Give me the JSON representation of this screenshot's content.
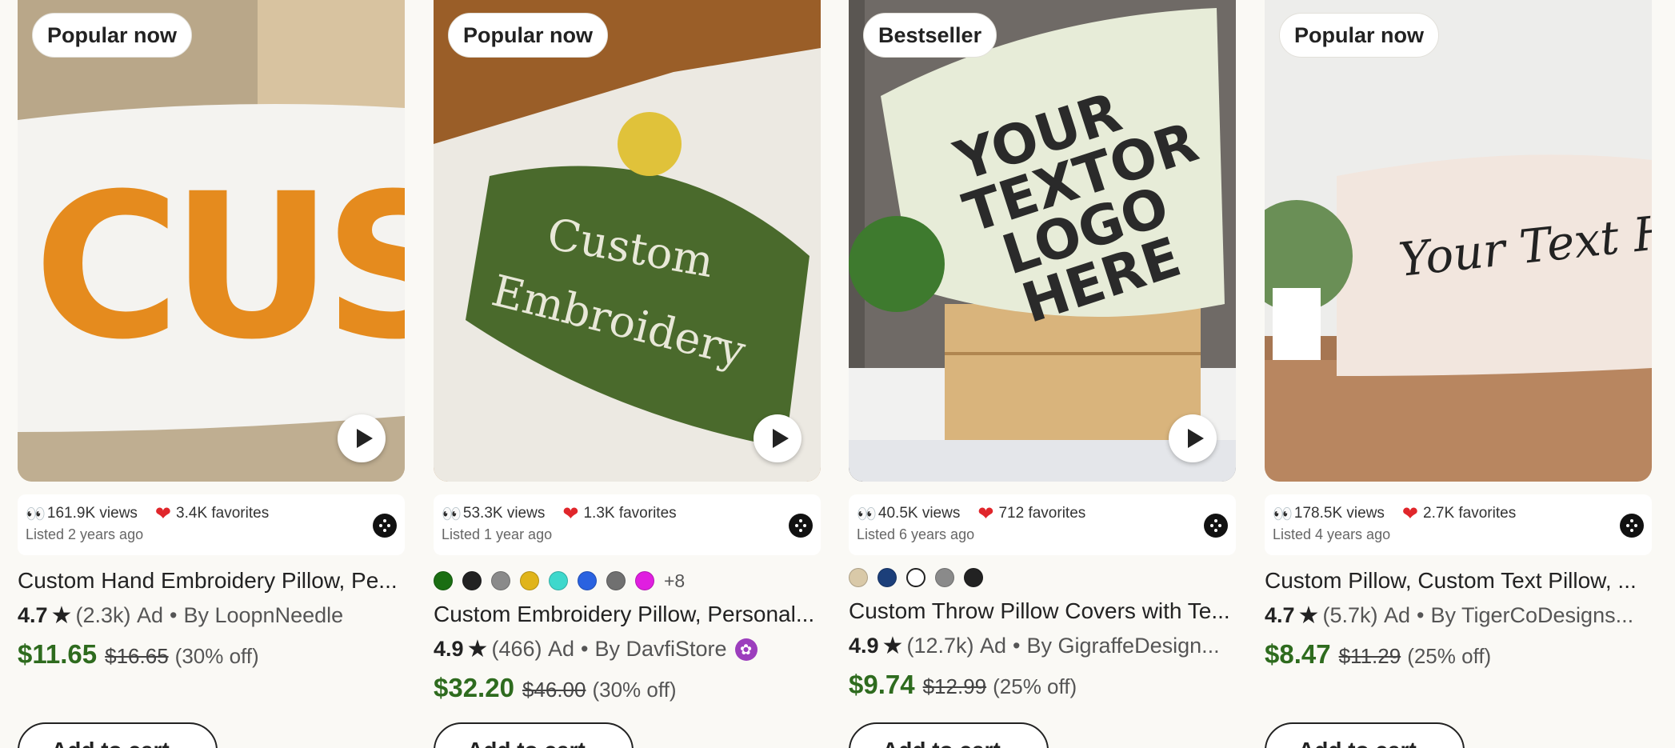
{
  "cards": [
    {
      "badge": "Popular now",
      "views": "161.9K views",
      "favorites": "3.4K favorites",
      "listed": "Listed 2 years ago",
      "title": "Custom Hand Embroidery Pillow, Pe...",
      "rating": "4.7",
      "reviews": "(2.3k)",
      "ad": "Ad",
      "shop": "By LoopnNeedle",
      "price": "$11.65",
      "original_price": "$16.65",
      "discount": "(30% off)",
      "add_label": "Add to cart"
    },
    {
      "badge": "Popular now",
      "views": "53.3K views",
      "favorites": "1.3K favorites",
      "listed": "Listed 1 year ago",
      "swatches": [
        "#1a6e12",
        "#222222",
        "#8a8a8a",
        "#e0b41a",
        "#3ed8cc",
        "#2a62e0",
        "#707070",
        "#e01ee0"
      ],
      "swatch_more": "+8",
      "title": "Custom Embroidery Pillow, Personal...",
      "rating": "4.9",
      "reviews": "(466)",
      "ad": "Ad",
      "shop": "By DavfiStore",
      "price": "$32.20",
      "original_price": "$46.00",
      "discount": "(30% off)",
      "add_label": "Add to cart",
      "photo_text_1": "Custom",
      "photo_text_2": "Embroidery"
    },
    {
      "badge": "Bestseller",
      "views": "40.5K views",
      "favorites": "712 favorites",
      "listed": "Listed 6 years ago",
      "swatches": [
        "#d9c9a8",
        "#1c3f7a",
        "#ffffff",
        "#8a8a8a",
        "#222222"
      ],
      "title": "Custom Throw Pillow Covers with Te...",
      "rating": "4.9",
      "reviews": "(12.7k)",
      "ad": "Ad",
      "shop": "By GigraffeDesign...",
      "price": "$9.74",
      "original_price": "$12.99",
      "discount": "(25% off)",
      "add_label": "Add to cart",
      "photo_text_1": "YOUR",
      "photo_text_2": "TEXTOR",
      "photo_text_3": "LOGO",
      "photo_text_4": "HERE"
    },
    {
      "badge": "Popular now",
      "views": "178.5K views",
      "favorites": "2.7K favorites",
      "listed": "Listed 4 years ago",
      "title": "Custom Pillow, Custom Text Pillow, ...",
      "rating": "4.7",
      "reviews": "(5.7k)",
      "ad": "Ad",
      "shop": "By TigerCoDesigns...",
      "price": "$8.47",
      "original_price": "$11.29",
      "discount": "(25% off)",
      "add_label": "Add to cart",
      "photo_text_1": "Your Text Her"
    }
  ],
  "photo_1_text": "CUSTO",
  "colors": {
    "price_green": "#2e6b1e",
    "heart_red": "#e0262b",
    "star_seller_purple": "#9c3ebd"
  }
}
